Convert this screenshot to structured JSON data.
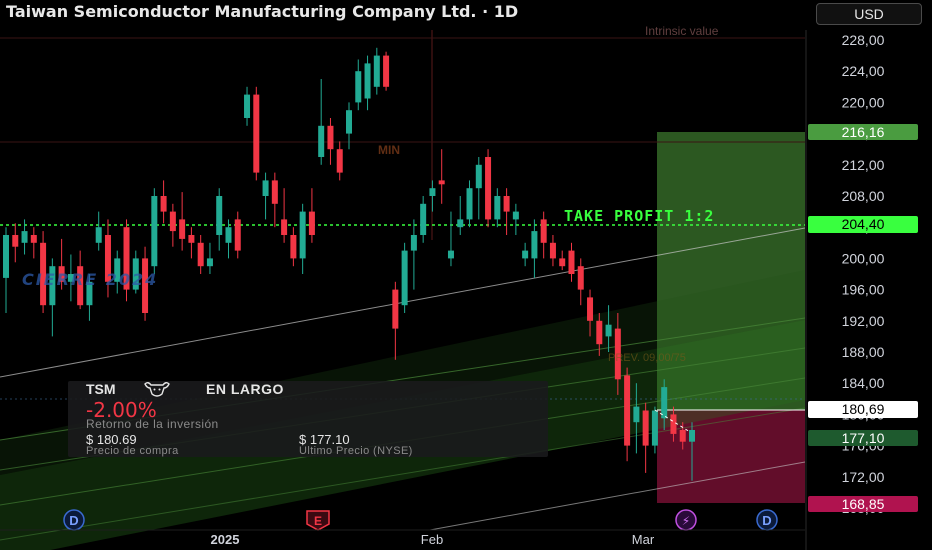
{
  "header": {
    "title": "Taiwan Semiconductor Manufacturing Company Ltd. · 1D",
    "currency_label": "USD"
  },
  "colors": {
    "background": "#000000",
    "bull": "#22ab94",
    "bear": "#f23645",
    "take_profit": "#39ff3f",
    "stop_zone": "#e91e63",
    "entry": "#ffffff"
  },
  "price_axis": {
    "ticks": [
      "228,00",
      "224,00",
      "220,00",
      "216,00",
      "212,00",
      "208,00",
      "204,00",
      "200,00",
      "196,00",
      "192,00",
      "188,00",
      "184,00",
      "180,00",
      "176,00",
      "172,00",
      "168,00"
    ]
  },
  "price_labels": {
    "take_profit_top": "216,16",
    "take_profit": "204,40",
    "entry": "180,69",
    "last": "177,10",
    "stop": "168,85"
  },
  "time_axis": {
    "labels": [
      "2025",
      "Feb",
      "Mar"
    ]
  },
  "annotations": {
    "take_profit": "TAKE PROFIT 1:2",
    "cierre": "CIERRE 2024",
    "intrinsic": "Intrinsic value",
    "min": "MIN",
    "prev": "PREV.  09,00/75"
  },
  "markers": {
    "dividend_left": "D",
    "earnings": "E",
    "split": "⚡",
    "dividend_right": "D"
  },
  "position_card": {
    "ticker": "TSM",
    "side": "EN LARGO",
    "return_value": "-2.00%",
    "return_label": "Retorno de la inversión",
    "buy_price": "$ 180.69",
    "buy_label": "Precio de compra",
    "last_price": "$ 177.10",
    "last_label": "Último Precio (NYSE)"
  },
  "chart_data": {
    "type": "candlestick",
    "y_range": [
      166,
      230
    ],
    "take_profit_level": 204.4,
    "tp_zone_top": 216.16,
    "entry_level": 180.69,
    "stop_level": 168.85,
    "last_price": 177.1,
    "candles": [
      {
        "o": 197.5,
        "c": 203.0,
        "h": 204.0,
        "l": 193.0
      },
      {
        "o": 203.0,
        "c": 201.5,
        "h": 204.5,
        "l": 199.5
      },
      {
        "o": 202.0,
        "c": 203.5,
        "h": 205.0,
        "l": 200.5
      },
      {
        "o": 203.0,
        "c": 202.0,
        "h": 204.0,
        "l": 200.0
      },
      {
        "o": 202.0,
        "c": 194.0,
        "h": 203.5,
        "l": 193.0
      },
      {
        "o": 194.0,
        "c": 199.0,
        "h": 200.0,
        "l": 190.0
      },
      {
        "o": 199.0,
        "c": 197.0,
        "h": 202.5,
        "l": 196.0
      },
      {
        "o": 197.0,
        "c": 198.0,
        "h": 200.5,
        "l": 194.5
      },
      {
        "o": 199.0,
        "c": 194.0,
        "h": 201.0,
        "l": 193.5
      },
      {
        "o": 194.0,
        "c": 197.0,
        "h": 198.0,
        "l": 192.0
      },
      {
        "o": 202.0,
        "c": 204.0,
        "h": 206.0,
        "l": 201.0
      },
      {
        "o": 203.0,
        "c": 197.0,
        "h": 205.0,
        "l": 195.0
      },
      {
        "o": 197.0,
        "c": 200.0,
        "h": 201.0,
        "l": 195.5
      },
      {
        "o": 204.0,
        "c": 196.0,
        "h": 205.0,
        "l": 194.5
      },
      {
        "o": 196.0,
        "c": 200.0,
        "h": 201.0,
        "l": 195.5
      },
      {
        "o": 200.0,
        "c": 193.0,
        "h": 201.5,
        "l": 192.0
      },
      {
        "o": 199.0,
        "c": 208.0,
        "h": 209.0,
        "l": 198.0
      },
      {
        "o": 208.0,
        "c": 206.0,
        "h": 210.0,
        "l": 204.5
      },
      {
        "o": 206.0,
        "c": 203.5,
        "h": 207.0,
        "l": 201.5
      },
      {
        "o": 205.0,
        "c": 202.5,
        "h": 208.5,
        "l": 201.0
      },
      {
        "o": 203.0,
        "c": 202.0,
        "h": 204.0,
        "l": 200.0
      },
      {
        "o": 202.0,
        "c": 199.0,
        "h": 203.0,
        "l": 198.0
      },
      {
        "o": 199.0,
        "c": 200.0,
        "h": 202.0,
        "l": 198.0
      },
      {
        "o": 203.0,
        "c": 208.0,
        "h": 209.0,
        "l": 201.0
      },
      {
        "o": 202.0,
        "c": 204.0,
        "h": 205.0,
        "l": 200.0
      },
      {
        "o": 205.0,
        "c": 201.0,
        "h": 206.0,
        "l": 200.0
      },
      {
        "o": 218.0,
        "c": 221.0,
        "h": 222.0,
        "l": 217.0
      },
      {
        "o": 221.0,
        "c": 211.0,
        "h": 222.0,
        "l": 210.0
      },
      {
        "o": 208.0,
        "c": 210.0,
        "h": 211.0,
        "l": 205.0
      },
      {
        "o": 210.0,
        "c": 207.0,
        "h": 211.0,
        "l": 204.0
      },
      {
        "o": 205.0,
        "c": 203.0,
        "h": 209.0,
        "l": 202.0
      },
      {
        "o": 203.0,
        "c": 200.0,
        "h": 204.0,
        "l": 199.0
      },
      {
        "o": 200.0,
        "c": 206.0,
        "h": 207.0,
        "l": 198.0
      },
      {
        "o": 206.0,
        "c": 203.0,
        "h": 209.0,
        "l": 202.0
      },
      {
        "o": 213.0,
        "c": 217.0,
        "h": 223.0,
        "l": 212.0
      },
      {
        "o": 217.0,
        "c": 214.0,
        "h": 218.0,
        "l": 212.0
      },
      {
        "o": 214.0,
        "c": 211.0,
        "h": 215.0,
        "l": 210.0
      },
      {
        "o": 216.0,
        "c": 219.0,
        "h": 220.0,
        "l": 214.0
      },
      {
        "o": 220.0,
        "c": 224.0,
        "h": 225.5,
        "l": 219.0
      },
      {
        "o": 220.5,
        "c": 225.0,
        "h": 226.0,
        "l": 219.0
      },
      {
        "o": 222.0,
        "c": 226.0,
        "h": 227.0,
        "l": 221.0
      },
      {
        "o": 226.0,
        "c": 222.0,
        "h": 226.5,
        "l": 221.5
      },
      {
        "o": 196.0,
        "c": 191.0,
        "h": 197.0,
        "l": 187.0
      },
      {
        "o": 194.0,
        "c": 201.0,
        "h": 202.0,
        "l": 193.0
      },
      {
        "o": 201.0,
        "c": 203.0,
        "h": 205.0,
        "l": 196.0
      },
      {
        "o": 203.0,
        "c": 207.0,
        "h": 208.0,
        "l": 202.0
      },
      {
        "o": 208.0,
        "c": 209.0,
        "h": 210.0,
        "l": 206.0
      },
      {
        "o": 210.0,
        "c": 209.5,
        "h": 214.0,
        "l": 207.0
      },
      {
        "o": 200.0,
        "c": 201.0,
        "h": 206.0,
        "l": 199.0
      },
      {
        "o": 204.0,
        "c": 205.0,
        "h": 208.0,
        "l": 203.0
      },
      {
        "o": 205.0,
        "c": 209.0,
        "h": 210.0,
        "l": 204.0
      },
      {
        "o": 209.0,
        "c": 212.0,
        "h": 213.0,
        "l": 205.0
      },
      {
        "o": 213.0,
        "c": 205.0,
        "h": 214.0,
        "l": 204.0
      },
      {
        "o": 205.0,
        "c": 208.0,
        "h": 209.0,
        "l": 204.0
      },
      {
        "o": 208.0,
        "c": 206.0,
        "h": 209.0,
        "l": 203.0
      },
      {
        "o": 205.0,
        "c": 206.0,
        "h": 207.0,
        "l": 203.0
      },
      {
        "o": 200.0,
        "c": 201.0,
        "h": 202.0,
        "l": 199.0
      },
      {
        "o": 200.0,
        "c": 203.5,
        "h": 205.0,
        "l": 197.5
      },
      {
        "o": 205.0,
        "c": 202.0,
        "h": 206.0,
        "l": 200.0
      },
      {
        "o": 202.0,
        "c": 200.0,
        "h": 203.0,
        "l": 199.0
      },
      {
        "o": 200.0,
        "c": 199.0,
        "h": 201.0,
        "l": 198.5
      },
      {
        "o": 201.0,
        "c": 198.0,
        "h": 202.0,
        "l": 197.0
      },
      {
        "o": 199.0,
        "c": 196.0,
        "h": 200.0,
        "l": 194.0
      },
      {
        "o": 195.0,
        "c": 192.0,
        "h": 196.0,
        "l": 190.0
      },
      {
        "o": 192.0,
        "c": 189.0,
        "h": 193.0,
        "l": 187.5
      },
      {
        "o": 190.0,
        "c": 191.5,
        "h": 194.0,
        "l": 188.0
      },
      {
        "o": 191.0,
        "c": 184.5,
        "h": 193.0,
        "l": 182.5
      },
      {
        "o": 185.0,
        "c": 176.0,
        "h": 186.0,
        "l": 174.0
      },
      {
        "o": 179.0,
        "c": 181.0,
        "h": 184.0,
        "l": 175.0
      },
      {
        "o": 180.5,
        "c": 176.0,
        "h": 181.5,
        "l": 172.5
      },
      {
        "o": 176.0,
        "c": 180.5,
        "h": 181.0,
        "l": 175.0
      },
      {
        "o": 179.5,
        "c": 183.5,
        "h": 184.5,
        "l": 178.0
      },
      {
        "o": 180.0,
        "c": 177.5,
        "h": 181.0,
        "l": 176.5
      },
      {
        "o": 178.0,
        "c": 176.5,
        "h": 179.0,
        "l": 175.5
      },
      {
        "o": 176.5,
        "c": 178.0,
        "h": 179.0,
        "l": 171.5
      }
    ]
  }
}
